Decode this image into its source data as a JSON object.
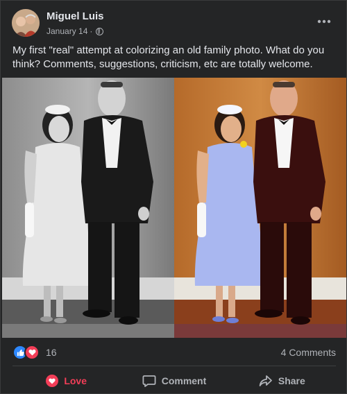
{
  "post": {
    "author": "Miguel Luis",
    "date": "January 14",
    "separator": "·",
    "privacy_icon": "globe-icon",
    "menu_icon": "more-horizontal-icon",
    "body": "My first \"real\" attempt at colorizing an old family photo. What do you think? Comments, suggestions, criticism, etc are totally welcome."
  },
  "stats": {
    "reaction_icons": [
      "like-icon",
      "love-icon"
    ],
    "reaction_count": "16",
    "comment_count": "4 Comments"
  },
  "actions": [
    {
      "label": "Love",
      "icon": "heart-icon",
      "active": true
    },
    {
      "label": "Comment",
      "icon": "comment-bubble-icon",
      "active": false
    },
    {
      "label": "Share",
      "icon": "share-arrow-icon",
      "active": false
    }
  ],
  "colors": {
    "background": "#242526",
    "text": "#e4e6eb",
    "secondary_text": "#b0b3b8",
    "love": "#f33e58",
    "like": "#2d88ff"
  }
}
